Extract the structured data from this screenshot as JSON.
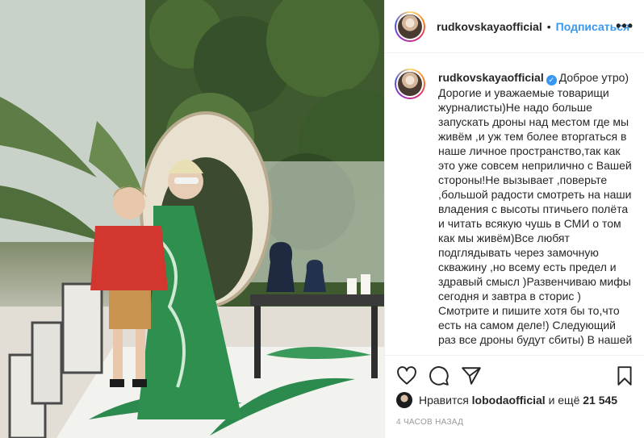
{
  "header": {
    "username": "rudkovskayaofficial",
    "separator": "•",
    "follow_label": "Подписаться",
    "more_label": "•••"
  },
  "caption": {
    "username": "rudkovskayaofficial",
    "verified_glyph": "✓",
    "text": "Доброе утро)\nДорогие и уважаемые товарищи журналисты)Не надо больше запускать дроны над местом где мы живём ,и уж тем более вторгаться в наше личное пространство,так как это уже совсем неприлично с Вашей стороны!Не вызывает ,поверьте ,большой радости смотреть на наши владения с высоты птичьего полёта и читать всякую чушь в СМИ о том как мы живём)Все любят подглядывать через замочную скважину ,но всему есть предел и здравый смысл )Развенчиваю мифы сегодня и завтра в сторис )\nСмотрите и пишите хотя бы то,что есть на самом деле!) Следующий раз все дроны будут сбиты) В нашей"
  },
  "actions": {
    "icons": [
      "heart-icon",
      "comment-icon",
      "share-icon",
      "bookmark-icon"
    ]
  },
  "likes": {
    "prefix": "Нравится",
    "user": "lobodaofficial",
    "middle": "и ещё",
    "count": "21 545"
  },
  "timestamp": "4 ЧАСОВ НАЗАД",
  "colors": {
    "accent": "#3897f0",
    "text": "#262626",
    "muted": "#999999",
    "border": "#efefef"
  }
}
